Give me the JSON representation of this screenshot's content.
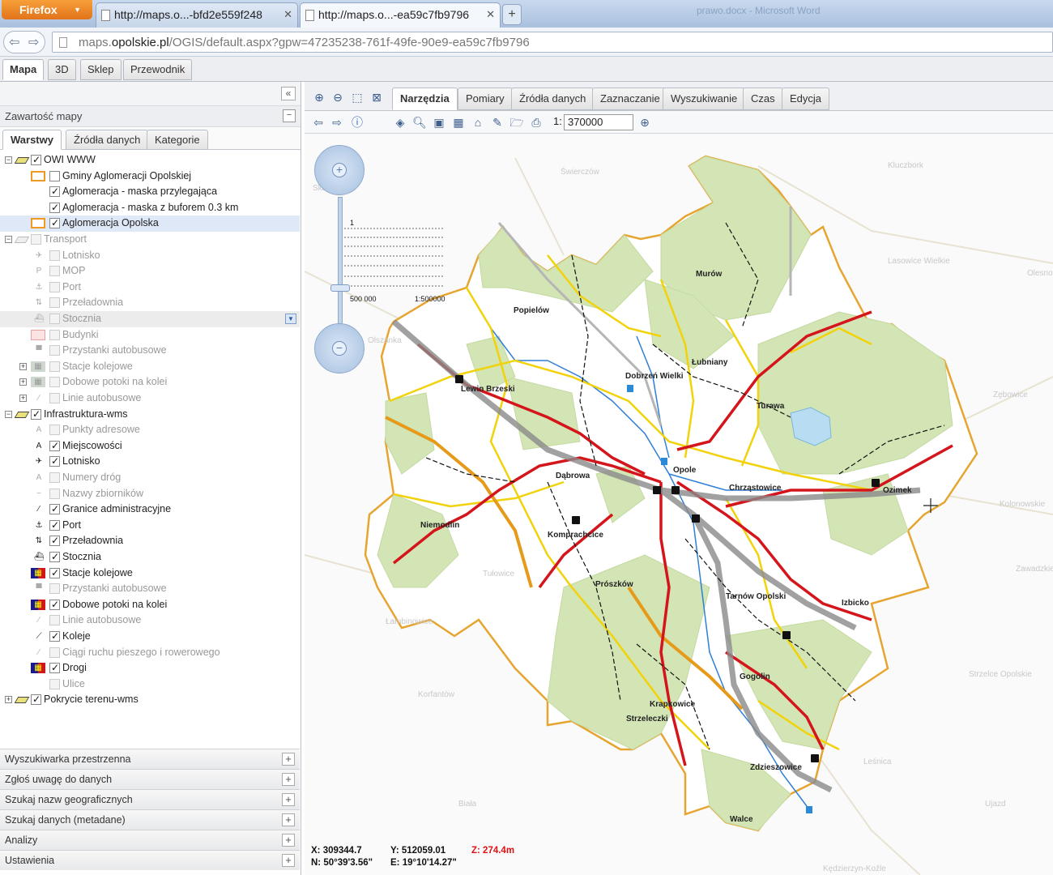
{
  "browser": {
    "app_button": "Firefox",
    "tabs": [
      {
        "title": "http://maps.o...-bfd2e559f248"
      },
      {
        "title": "http://maps.o...-ea59c7fb9796"
      }
    ],
    "new_tab_label": "+",
    "background_window_title": "prawo.docx - Microsoft Word",
    "url_prefix": "maps.",
    "url_domain": "opolskie.pl",
    "url_rest": "/OGIS/default.aspx?gpw=47235238-761f-49fe-90e9-ea59c7fb9796"
  },
  "app_tabs": [
    "Mapa",
    "3D",
    "Sklep",
    "Przewodnik"
  ],
  "left_panel": {
    "collapse_icon": "«",
    "header": "Zawartość mapy",
    "subtabs": [
      "Warstwy",
      "Źródła danych",
      "Kategorie"
    ],
    "tree": [
      {
        "label": "OWI WWW",
        "level": 0,
        "exp": "−",
        "checked": true,
        "enabled": true
      },
      {
        "label": "Gminy Aglomeracji Opolskiej",
        "level": 1,
        "checked": false,
        "enabled": true,
        "legend": "orange-box"
      },
      {
        "label": "Aglomeracja - maska przylegająca",
        "level": 1,
        "checked": true,
        "enabled": true
      },
      {
        "label": "Aglomeracja - maska z buforem 0.3 km",
        "level": 1,
        "checked": true,
        "enabled": true
      },
      {
        "label": "Aglomeracja Opolska",
        "level": 1,
        "checked": true,
        "enabled": true,
        "legend": "orange-box",
        "selected": true
      },
      {
        "label": "Transport",
        "level": 0,
        "exp": "−",
        "checked": false,
        "enabled": false
      },
      {
        "label": "Lotnisko",
        "level": 1,
        "checked": false,
        "enabled": false
      },
      {
        "label": "MOP",
        "level": 1,
        "checked": false,
        "enabled": false
      },
      {
        "label": "Port",
        "level": 1,
        "checked": false,
        "enabled": false
      },
      {
        "label": "Przeładownia",
        "level": 1,
        "checked": false,
        "enabled": false
      },
      {
        "label": "Stocznia",
        "level": 1,
        "checked": false,
        "enabled": false,
        "hover": true
      },
      {
        "label": "Budynki",
        "level": 1,
        "checked": false,
        "enabled": false,
        "legend": "pink-box"
      },
      {
        "label": "Przystanki autobusowe",
        "level": 1,
        "checked": false,
        "enabled": false
      },
      {
        "label": "Stacje kolejowe",
        "level": 1,
        "exp": "+",
        "checked": false,
        "enabled": false
      },
      {
        "label": "Dobowe potoki na kolei",
        "level": 1,
        "exp": "+",
        "checked": false,
        "enabled": false
      },
      {
        "label": "Linie autobusowe",
        "level": 1,
        "exp": "+",
        "checked": false,
        "enabled": false
      },
      {
        "label": "Infrastruktura-wms",
        "level": 0,
        "exp": "−",
        "checked": true,
        "enabled": true
      },
      {
        "label": "Punkty adresowe",
        "level": 1,
        "checked": false,
        "enabled": false
      },
      {
        "label": "Miejscowości",
        "level": 1,
        "checked": true,
        "enabled": true
      },
      {
        "label": "Lotnisko",
        "level": 1,
        "checked": true,
        "enabled": true
      },
      {
        "label": "Numery dróg",
        "level": 1,
        "checked": false,
        "enabled": false
      },
      {
        "label": "Nazwy zbiorników",
        "level": 1,
        "checked": false,
        "enabled": false
      },
      {
        "label": "Granice administracyjne",
        "level": 1,
        "checked": true,
        "enabled": true
      },
      {
        "label": "Port",
        "level": 1,
        "checked": true,
        "enabled": true
      },
      {
        "label": "Przeładownia",
        "level": 1,
        "checked": true,
        "enabled": true
      },
      {
        "label": "Stocznia",
        "level": 1,
        "checked": true,
        "enabled": true
      },
      {
        "label": "Stacje kolejowe",
        "level": 1,
        "checked": true,
        "enabled": true
      },
      {
        "label": "Przystanki autobusowe",
        "level": 1,
        "checked": false,
        "enabled": false
      },
      {
        "label": "Dobowe potoki na kolei",
        "level": 1,
        "checked": true,
        "enabled": true
      },
      {
        "label": "Linie autobusowe",
        "level": 1,
        "checked": false,
        "enabled": false
      },
      {
        "label": "Koleje",
        "level": 1,
        "checked": true,
        "enabled": true
      },
      {
        "label": "Ciągi ruchu pieszego i rowerowego",
        "level": 1,
        "checked": false,
        "enabled": false
      },
      {
        "label": "Drogi",
        "level": 1,
        "checked": true,
        "enabled": true
      },
      {
        "label": "Ulice",
        "level": 1,
        "checked": false,
        "enabled": false
      },
      {
        "label": "Pokrycie terenu-wms",
        "level": 0,
        "exp": "+",
        "checked": true,
        "enabled": true
      }
    ],
    "accordions": [
      "Wyszukiwarka przestrzenna",
      "Zgłoś uwagę do danych",
      "Szukaj nazw geograficznych",
      "Szukaj danych (metadane)",
      "Analizy",
      "Ustawienia"
    ]
  },
  "map_panel": {
    "tool_tabs": [
      "Narzędzia",
      "Pomiary",
      "Źródła danych",
      "Zaznaczanie",
      "Wyszukiwanie",
      "Czas",
      "Edycja"
    ],
    "scale_prefix": "1:",
    "scale_value": "370000",
    "zoom_scale_top": "1",
    "zoom_scale_bottom_left": "500 000",
    "zoom_scale_bottom_right": "1:500000",
    "coords": {
      "x": "X: 309344.7",
      "y": "Y: 512059.01",
      "z": "Z: 274.4m",
      "n": "N: 50°39'3.56\"",
      "e": "E: 19°10'14.27\""
    },
    "places": [
      {
        "name": "Popielów"
      },
      {
        "name": "Murów"
      },
      {
        "name": "Łubniany"
      },
      {
        "name": "Dobrzeń Wielki"
      },
      {
        "name": "Lewin Brzeski"
      },
      {
        "name": "Turawa"
      },
      {
        "name": "Opole"
      },
      {
        "name": "Dąbrowa"
      },
      {
        "name": "Chrząstowice"
      },
      {
        "name": "Ozimek"
      },
      {
        "name": "Niemodlin"
      },
      {
        "name": "Komprachcice"
      },
      {
        "name": "Prószków"
      },
      {
        "name": "Tarnów Opolski"
      },
      {
        "name": "Izbicko"
      },
      {
        "name": "Gogolin"
      },
      {
        "name": "Krapkowice"
      },
      {
        "name": "Strzeleczki"
      },
      {
        "name": "Zdzieszowice"
      },
      {
        "name": "Walce"
      }
    ],
    "bg_places": [
      {
        "name": "Kluczbork"
      },
      {
        "name": "Lasowice Wielkie"
      },
      {
        "name": "Olesno"
      },
      {
        "name": "Zębowice"
      },
      {
        "name": "Kolonowskie"
      },
      {
        "name": "Zawadzkie"
      },
      {
        "name": "Strzelce Opolskie"
      },
      {
        "name": "Ujazd"
      },
      {
        "name": "Leśnica"
      },
      {
        "name": "Biała"
      },
      {
        "name": "Korfantów"
      },
      {
        "name": "Łambinowice"
      },
      {
        "name": "Tułowice"
      },
      {
        "name": "Olszanka"
      },
      {
        "name": "Skarbimierz"
      },
      {
        "name": "Świerczów"
      },
      {
        "name": "Kędzierzyn-Koźle"
      }
    ]
  }
}
